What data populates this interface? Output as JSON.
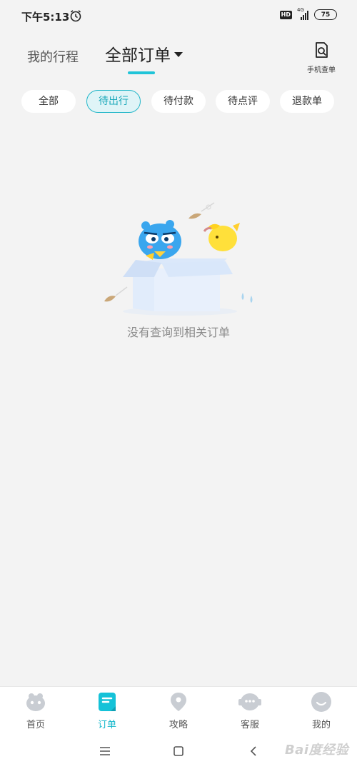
{
  "status_bar": {
    "time": "下午5:13",
    "hd": "HD",
    "network": "4G",
    "battery": "75"
  },
  "header": {
    "tab_trip": "我的行程",
    "tab_all_orders": "全部订单",
    "phone_lookup_label": "手机查单"
  },
  "filters": [
    "全部",
    "待出行",
    "待付款",
    "待点评",
    "退款单"
  ],
  "empty_state": {
    "message": "没有查询到相关订单"
  },
  "bottom_nav": [
    {
      "label": "首页",
      "icon": "home-mascot-icon"
    },
    {
      "label": "订单",
      "icon": "order-icon"
    },
    {
      "label": "攻略",
      "icon": "location-pin-icon"
    },
    {
      "label": "客服",
      "icon": "customer-service-icon"
    },
    {
      "label": "我的",
      "icon": "profile-face-icon"
    }
  ],
  "active_nav": "订单",
  "active_filter": "待出行",
  "colors": {
    "accent": "#20c4d8",
    "background": "#f3f3f3"
  },
  "watermark": "Bai度经验"
}
